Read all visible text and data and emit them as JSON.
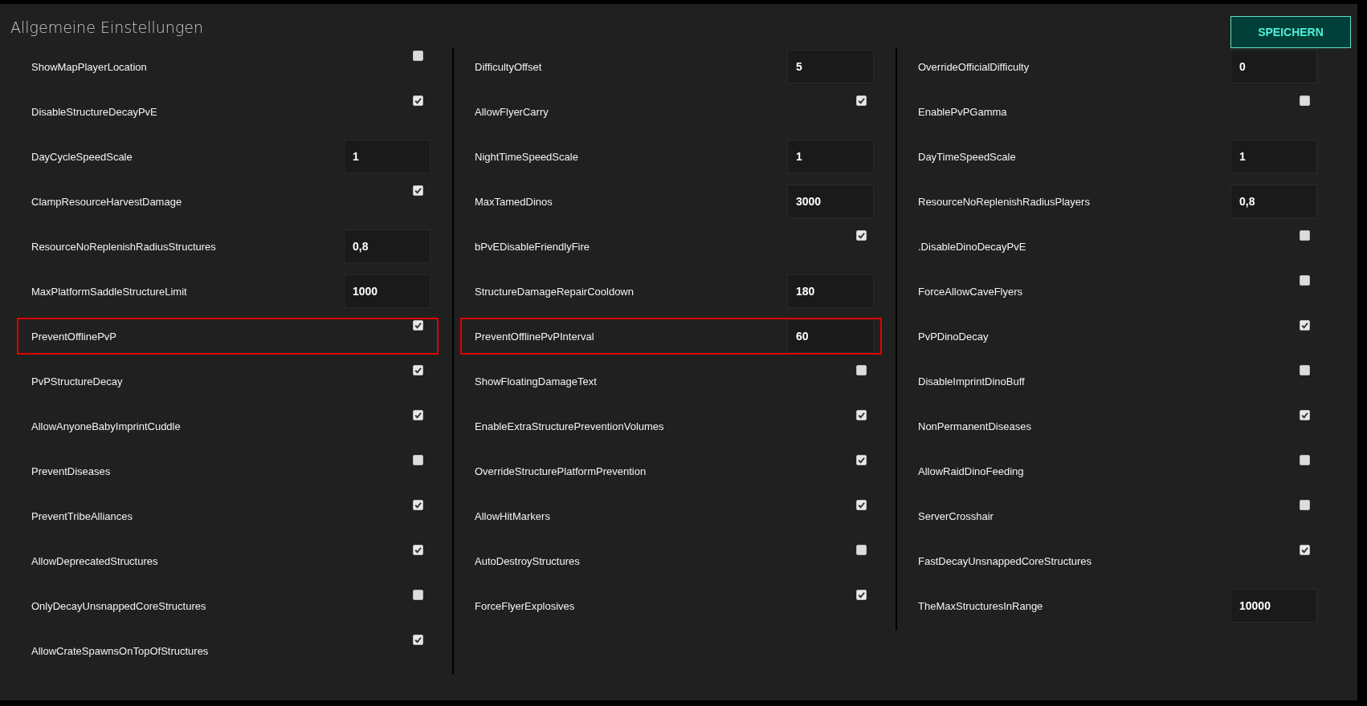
{
  "title": "Allgemeine Einstellungen",
  "save_button": "SPEICHERN",
  "columns": [
    [
      {
        "label": "ShowMapPlayerLocation",
        "kind": "checkbox",
        "checked": false,
        "highlighted": false
      },
      {
        "label": "DisableStructureDecayPvE",
        "kind": "checkbox",
        "checked": true,
        "highlighted": false
      },
      {
        "label": "DayCycleSpeedScale",
        "kind": "number",
        "value": "1",
        "highlighted": false
      },
      {
        "label": "ClampResourceHarvestDamage",
        "kind": "checkbox",
        "checked": true,
        "highlighted": false
      },
      {
        "label": "ResourceNoReplenishRadiusStructures",
        "kind": "number",
        "value": "0,8",
        "highlighted": false
      },
      {
        "label": "MaxPlatformSaddleStructureLimit",
        "kind": "number",
        "value": "1000",
        "highlighted": false
      },
      {
        "label": "PreventOfflinePvP",
        "kind": "checkbox",
        "checked": true,
        "highlighted": true
      },
      {
        "label": "PvPStructureDecay",
        "kind": "checkbox",
        "checked": true,
        "highlighted": false
      },
      {
        "label": "AllowAnyoneBabyImprintCuddle",
        "kind": "checkbox",
        "checked": true,
        "highlighted": false
      },
      {
        "label": "PreventDiseases",
        "kind": "checkbox",
        "checked": false,
        "highlighted": false
      },
      {
        "label": "PreventTribeAlliances",
        "kind": "checkbox",
        "checked": true,
        "highlighted": false
      },
      {
        "label": "AllowDeprecatedStructures",
        "kind": "checkbox",
        "checked": true,
        "highlighted": false
      },
      {
        "label": "OnlyDecayUnsnappedCoreStructures",
        "kind": "checkbox",
        "checked": false,
        "highlighted": false
      },
      {
        "label": "AllowCrateSpawnsOnTopOfStructures",
        "kind": "checkbox",
        "checked": true,
        "highlighted": false
      }
    ],
    [
      {
        "label": "DifficultyOffset",
        "kind": "number",
        "value": "5",
        "highlighted": false
      },
      {
        "label": "AllowFlyerCarry",
        "kind": "checkbox",
        "checked": true,
        "highlighted": false
      },
      {
        "label": "NightTimeSpeedScale",
        "kind": "number",
        "value": "1",
        "highlighted": false
      },
      {
        "label": "MaxTamedDinos",
        "kind": "number",
        "value": "3000",
        "highlighted": false
      },
      {
        "label": "bPvEDisableFriendlyFire",
        "kind": "checkbox",
        "checked": true,
        "highlighted": false
      },
      {
        "label": "StructureDamageRepairCooldown",
        "kind": "number",
        "value": "180",
        "highlighted": false
      },
      {
        "label": "PreventOfflinePvPInterval",
        "kind": "number",
        "value": "60",
        "highlighted": true
      },
      {
        "label": "ShowFloatingDamageText",
        "kind": "checkbox",
        "checked": false,
        "highlighted": false
      },
      {
        "label": "EnableExtraStructurePreventionVolumes",
        "kind": "checkbox",
        "checked": true,
        "highlighted": false
      },
      {
        "label": "OverrideStructurePlatformPrevention",
        "kind": "checkbox",
        "checked": true,
        "highlighted": false
      },
      {
        "label": "AllowHitMarkers",
        "kind": "checkbox",
        "checked": true,
        "highlighted": false
      },
      {
        "label": "AutoDestroyStructures",
        "kind": "checkbox",
        "checked": false,
        "highlighted": false
      },
      {
        "label": "ForceFlyerExplosives",
        "kind": "checkbox",
        "checked": true,
        "highlighted": false
      }
    ],
    [
      {
        "label": "OverrideOfficialDifficulty",
        "kind": "number",
        "value": "0",
        "highlighted": false
      },
      {
        "label": "EnablePvPGamma",
        "kind": "checkbox",
        "checked": false,
        "highlighted": false
      },
      {
        "label": "DayTimeSpeedScale",
        "kind": "number",
        "value": "1",
        "highlighted": false
      },
      {
        "label": "ResourceNoReplenishRadiusPlayers",
        "kind": "number",
        "value": "0,8",
        "highlighted": false
      },
      {
        "label": ".DisableDinoDecayPvE",
        "kind": "checkbox",
        "checked": false,
        "highlighted": false
      },
      {
        "label": "ForceAllowCaveFlyers",
        "kind": "checkbox",
        "checked": false,
        "highlighted": false
      },
      {
        "label": "PvPDinoDecay",
        "kind": "checkbox",
        "checked": true,
        "highlighted": false
      },
      {
        "label": "DisableImprintDinoBuff",
        "kind": "checkbox",
        "checked": false,
        "highlighted": false
      },
      {
        "label": "NonPermanentDiseases",
        "kind": "checkbox",
        "checked": true,
        "highlighted": false
      },
      {
        "label": "AllowRaidDinoFeeding",
        "kind": "checkbox",
        "checked": false,
        "highlighted": false
      },
      {
        "label": "ServerCrosshair",
        "kind": "checkbox",
        "checked": false,
        "highlighted": false
      },
      {
        "label": "FastDecayUnsnappedCoreStructures",
        "kind": "checkbox",
        "checked": true,
        "highlighted": false
      },
      {
        "label": "TheMaxStructuresInRange",
        "kind": "number",
        "value": "10000",
        "highlighted": false
      }
    ]
  ]
}
